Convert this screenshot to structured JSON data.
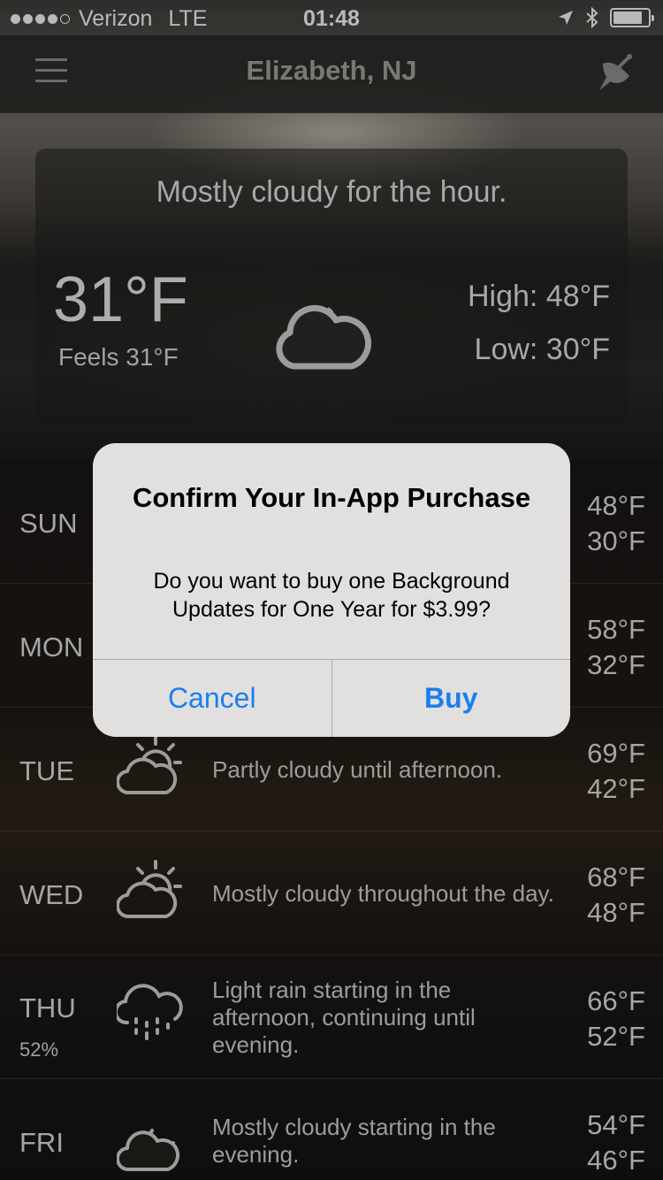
{
  "status_bar": {
    "carrier": "Verizon",
    "network": "LTE",
    "time": "01:48",
    "signal_bars": 4,
    "signal_total": 5,
    "battery_level": 0.85
  },
  "nav": {
    "title": "Elizabeth, NJ",
    "menu_icon": "hamburger-menu-icon",
    "right_icon": "satellite-dish-icon"
  },
  "current": {
    "summary": "Mostly cloudy for the hour.",
    "temp": "31°F",
    "feels": "Feels 31°F",
    "high": "High: 48°F",
    "low": "Low: 30°F",
    "icon": "mostly-cloudy-night-icon"
  },
  "forecast": [
    {
      "day": "SUN",
      "pop": "",
      "icon": "",
      "summary": "",
      "high": "48°F",
      "low": "30°F"
    },
    {
      "day": "MON",
      "pop": "",
      "icon": "",
      "summary": "",
      "high": "58°F",
      "low": "32°F"
    },
    {
      "day": "TUE",
      "pop": "",
      "icon": "partly-cloudy-day-icon",
      "summary": "Partly cloudy until afternoon.",
      "high": "69°F",
      "low": "42°F"
    },
    {
      "day": "WED",
      "pop": "",
      "icon": "partly-cloudy-day-icon",
      "summary": "Mostly cloudy throughout the day.",
      "high": "68°F",
      "low": "48°F"
    },
    {
      "day": "THU",
      "pop": "52%",
      "icon": "rain-icon",
      "summary": "Light rain starting in the afternoon, continuing until evening.",
      "high": "66°F",
      "low": "52°F"
    },
    {
      "day": "FRI",
      "pop": "",
      "icon": "partly-cloudy-night-icon",
      "summary": "Mostly cloudy starting in the evening.",
      "high": "54°F",
      "low": "46°F"
    }
  ],
  "alert": {
    "title": "Confirm Your In-App Purchase",
    "message": "Do you want to buy one Background Updates for One Year for $3.99?",
    "cancel_label": "Cancel",
    "buy_label": "Buy",
    "button_color": "#1a7ef2"
  }
}
